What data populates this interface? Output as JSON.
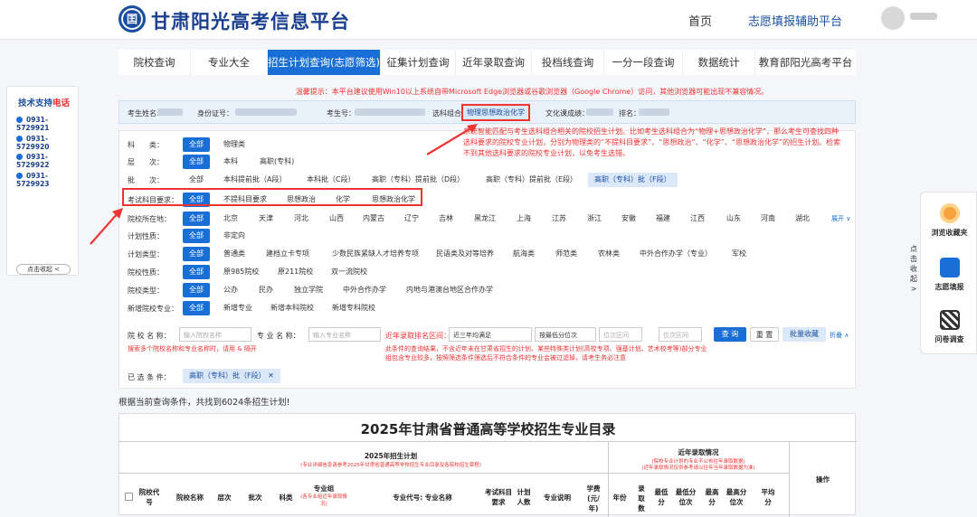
{
  "header": {
    "logo_glyph": "囯",
    "site_title": "甘肃阳光高考信息平台",
    "nav_home": "首页",
    "nav_assist": "志愿填报辅助平台"
  },
  "tabs": [
    {
      "label": "院校查询"
    },
    {
      "label": "专业大全"
    },
    {
      "label": "招生计划查询(志愿筛选)"
    },
    {
      "label": "征集计划查询"
    },
    {
      "label": "近年录取查询"
    },
    {
      "label": "投档线查询"
    },
    {
      "label": "一分一段查询"
    },
    {
      "label": "数据统计"
    },
    {
      "label": "教育部阳光高考平台"
    }
  ],
  "notice": "温馨提示：本平台建议使用Win10以上系统自带Microsoft Edge浏览器或谷歌浏览器（Google Chrome）访问，其他浏览器可能出现不兼容情况。",
  "formbar": {
    "name_label": "考生姓名：",
    "id_label": "身份证号：",
    "exam_no_label": "考生号：",
    "combo_label": "选科组合：",
    "combo_value": "物理思想政治化学",
    "score_label": "文化课成绩：",
    "rank_label": "排名："
  },
  "callout": "系统智能匹配与考生选科组合相关的院校招生计划。比如考生选科组合为“物理+思想政治化学”，那么考生可查找四种选科要求的院校专业计划，分别为物理类的“不提科目要求”、“思想政治”、“化学”、“思想政治化学”的招生计划。检索不到其他选科要求的院校专业计划，以免考生选错。",
  "filters": {
    "subject": {
      "label": "科　　类：",
      "options": [
        "全部",
        "物理类"
      ]
    },
    "level": {
      "label": "层　　次：",
      "options": [
        "全部",
        "本科",
        "高职(专科)"
      ]
    },
    "batch": {
      "label": "批　　次：",
      "options": [
        "全部",
        "本科提前批（A段）",
        "本科批（C段）",
        "高职（专科）提前批（D段）",
        "高职（专科）提前批（E段）",
        "高职（专科）批（F段）"
      ]
    },
    "exam_req": {
      "label": "考试科目要求：",
      "options": [
        "全部",
        "不提科目要求",
        "思想政治",
        "化学",
        "思想政治化学"
      ]
    },
    "location": {
      "label": "院校所在地：",
      "options": [
        "全部",
        "北京",
        "天津",
        "河北",
        "山西",
        "内蒙古",
        "辽宁",
        "吉林",
        "黑龙江",
        "上海",
        "江苏",
        "浙江",
        "安徽",
        "福建",
        "江西",
        "山东",
        "河南",
        "湖北"
      ],
      "expand": "展开 ∨"
    },
    "plan_nature": {
      "label": "计划性质：",
      "options": [
        "全部",
        "非定向"
      ]
    },
    "plan_type": {
      "label": "计划类型：",
      "options": [
        "全部",
        "普通类",
        "建档立卡专项",
        "少数民族紧缺人才培养专项",
        "民语类及对等培养",
        "航海类",
        "师范类",
        "农林类",
        "中外合作办学（专业）",
        "军校"
      ]
    },
    "school_nature": {
      "label": "院校性质：",
      "options": [
        "全部",
        "原985院校",
        "原211院校",
        "双一流院校"
      ]
    },
    "school_type": {
      "label": "院校类型：",
      "options": [
        "全部",
        "公办",
        "民办",
        "独立学院",
        "中外合作办学",
        "内地与港澳台地区合作办学"
      ]
    },
    "new_major": {
      "label": "新增院校专业：",
      "options": [
        "全部",
        "新增专业",
        "新增本科院校",
        "新增专科院校"
      ]
    }
  },
  "search": {
    "school_label": "院 校 名 称：",
    "school_placeholder": "输入院校名称",
    "major_label": "专 业 名 称：",
    "major_placeholder": "输入专业名称",
    "rank_label": "近年录取排名区间：",
    "year_select": "近三年均满足",
    "order_select": "按最低分位次",
    "range_from": "位次区间",
    "range_to": "位次区间",
    "query_btn": "查 询",
    "reset_btn": "重 置",
    "batch_fav_btn": "批量收藏",
    "more_btn": "折叠 ∧",
    "hint_left": "搜索多个院校名称和专业名称时，请用 & 隔开",
    "hint_right": "此条件的查询结果，不含近年未在甘肃省招生的计划、某些特殊类计划(高校专项、强基计划、艺术校考等)部分专业组包含专业较多，按照筛选条件筛选后不符合条件的专业会被过滤掉，请考生务必注意"
  },
  "selected": {
    "label": "已 选 条 件：",
    "tag": "高职（专科）批（F段）",
    "tag_close": "✕"
  },
  "result_count": "根据当前查询条件，共找到6024条招生计划!",
  "table": {
    "title": "2025年甘肃省普通高等学校招生专业目录",
    "group_plan": "2025年招生计划",
    "group_plan_note": "(专业详细信息请参考2025年甘肃省普通高等学校招生专业目录及各院校招生章程)",
    "group_history": "近年录取情况",
    "group_history_note1": "(院校专业计划的专业不公布往年录取数据)",
    "group_history_note2": "(近年录取情况仅供参考请以往年当年录取数据为准)",
    "operation": "操作",
    "columns": [
      "院校代号",
      "院校名称",
      "层次",
      "批次",
      "科类",
      "专业组",
      "专业代号: 专业名称",
      "考试科目要求",
      "计划人数",
      "专业说明",
      "学费(元/年)",
      "年份",
      "录取数",
      "最低分",
      "最低分位次",
      "最高分",
      "最高分位次",
      "平均分"
    ],
    "group_col_note": "(各专业组近年录取情况)"
  },
  "support": {
    "title_a": "技术支持",
    "title_b": "电话",
    "phones": [
      "0931-5729921",
      "0931-5729920",
      "0931-5729922",
      "0931-5729923"
    ],
    "collapse": "点击收起 <"
  },
  "side_tools": {
    "fold_tab": "点击收起 >",
    "items": [
      "浏览收藏夹",
      "志愿填报",
      "问卷调查"
    ]
  },
  "colors": {
    "primary": "#1a6fd6",
    "brand": "#1a3f8f",
    "alert": "#ee3333",
    "highlight": "#dbe8f8"
  }
}
